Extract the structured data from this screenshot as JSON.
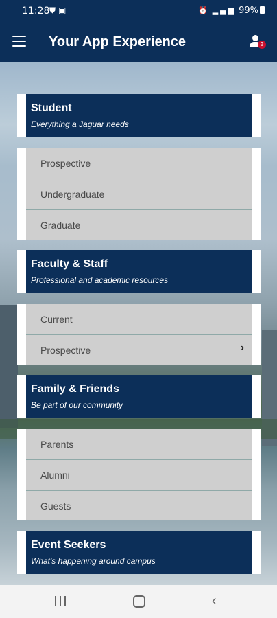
{
  "status_bar": {
    "time": "11:28",
    "battery": "99%",
    "icons": [
      "shield-icon",
      "gallery-icon",
      "alarm-icon",
      "wifi-icon",
      "signal-icon",
      "battery-icon"
    ]
  },
  "app_bar": {
    "title": "Your App Experience",
    "notification_count": "2"
  },
  "sections": [
    {
      "title": "Student",
      "subtitle": "Everything a Jaguar needs",
      "items": [
        {
          "label": "Prospective"
        },
        {
          "label": "Undergraduate"
        },
        {
          "label": "Graduate"
        }
      ]
    },
    {
      "title": "Faculty & Staff",
      "subtitle": "Professional and academic resources",
      "items": [
        {
          "label": "Current"
        },
        {
          "label": "Prospective",
          "chevron": "›"
        }
      ]
    },
    {
      "title": "Family & Friends",
      "subtitle": "Be part of our community",
      "items": [
        {
          "label": "Parents"
        },
        {
          "label": "Alumni"
        },
        {
          "label": "Guests"
        }
      ]
    },
    {
      "title": "Event Seekers",
      "subtitle": "What's happening around campus"
    }
  ],
  "colors": {
    "brand_navy": "#0c2f59",
    "list_bg": "#cfcfcf",
    "badge_red": "#c8102e"
  }
}
